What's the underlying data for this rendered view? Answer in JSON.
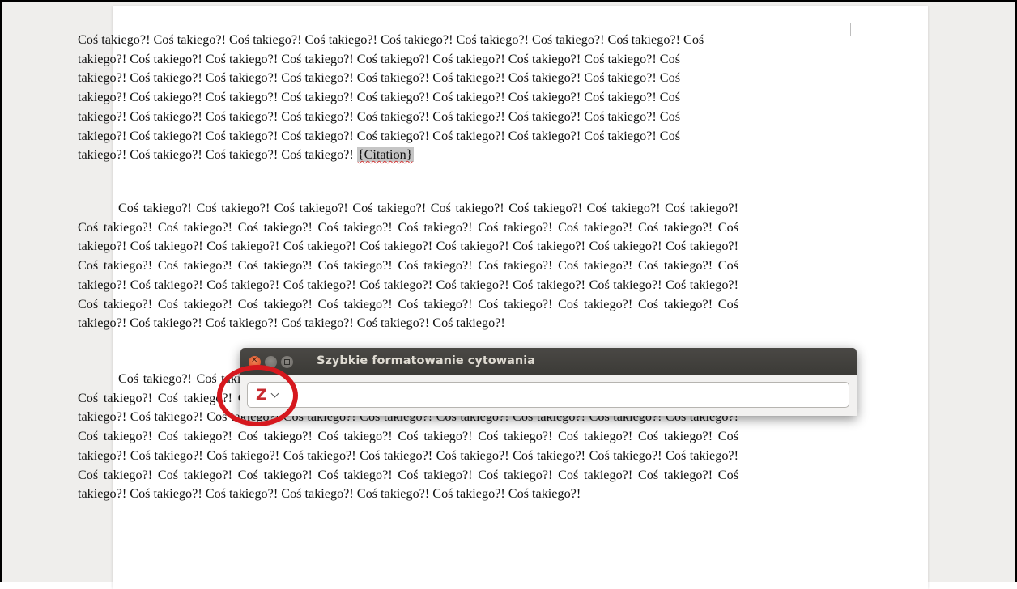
{
  "document": {
    "paragraph_1": "Coś takiego?! Coś takiego?! Coś takiego?! Coś takiego?! Coś takiego?! Coś takiego?! Coś takiego?! Coś takiego?! Coś takiego?! Coś takiego?! Coś takiego?! Coś takiego?! Coś takiego?! Coś takiego?! Coś takiego?! Coś takiego?! Coś takiego?! Coś takiego?! Coś takiego?! Coś takiego?! Coś takiego?! Coś takiego?! Coś takiego?! Coś takiego?! Coś takiego?! Coś takiego?! Coś takiego?! Coś takiego?! Coś takiego?! Coś takiego?! Coś takiego?! Coś takiego?! Coś takiego?! Coś takiego?! Coś takiego?! Coś takiego?! Coś takiego?! Coś takiego?! Coś takiego?! Coś takiego?! Coś takiego?! Coś takiego?! Coś takiego?! Coś takiego?! Coś takiego?! Coś takiego?! Coś takiego?! Coś takiego?! Coś takiego?! Coś takiego?! Coś takiego?! Coś takiego?!",
    "citation_field": "{Citation}",
    "paragraph_2": "Coś takiego?! Coś takiego?! Coś takiego?! Coś takiego?! Coś takiego?! Coś takiego?! Coś takiego?! Coś takiego?! Coś takiego?! Coś takiego?! Coś takiego?! Coś takiego?! Coś takiego?! Coś takiego?! Coś takiego?! Coś takiego?! Coś takiego?! Coś takiego?! Coś takiego?! Coś takiego?! Coś takiego?! Coś takiego?! Coś takiego?! Coś takiego?! Coś takiego?! Coś takiego?! Coś takiego?! Coś takiego?! Coś takiego?! Coś takiego?! Coś takiego?! Coś takiego?! Coś takiego?! Coś takiego?! Coś takiego?! Coś takiego?! Coś takiego?! Coś takiego?! Coś takiego?! Coś takiego?! Coś takiego?! Coś takiego?! Coś takiego?! Coś takiego?! Coś takiego?! Coś takiego?! Coś takiego?! Coś takiego?! Coś takiego?! Coś takiego?! Coś takiego?! Coś takiego?! Coś takiego?! Coś takiego?! Coś takiego?! Coś takiego?!",
    "paragraph_3": "Coś takiego?! Coś takiego?! Coś takiego?! Coś takiego?! Coś takiego?! Coś takiego?! Coś takiego?! Coś takiego?! Coś takiego?! Coś takiego?! Coś takiego?! Coś takiego?! Coś takiego?! Coś takiego?! Coś takiego?! Coś takiego?! Coś takiego?! Coś takiego?! Coś takiego?! Coś takiego?! Coś takiego?! Coś takiego?! Coś takiego?! Coś takiego?! Coś takiego?! Coś takiego?! Coś takiego?! Coś takiego?! Coś takiego?! Coś takiego?! Coś takiego?! Coś takiego?! Coś takiego?! Coś takiego?! Coś takiego?! Coś takiego?! Coś takiego?! Coś takiego?! Coś takiego?! Coś takiego?! Coś takiego?! Coś takiego?! Coś takiego?! Coś takiego?! Coś takiego?! Coś takiego?! Coś takiego?! Coś takiego?! Coś takiego?! Coś takiego?! Coś takiego?! Coś takiego?! Coś takiego?! Coś takiego?! Coś takiego?! Coś takiego?! Coś takiego?!"
  },
  "dialog": {
    "title": "Szybkie formatowanie cytowania",
    "buttons": {
      "close_icon": "close-icon",
      "minimize_icon": "minimize-icon",
      "maximize_icon": "maximize-icon"
    },
    "search": {
      "value": "",
      "zotero_button_label": "Z",
      "zotero_icon": "zotero-logo-icon",
      "dropdown_icon": "chevron-down-icon"
    }
  },
  "annotation": {
    "color": "#d6181e"
  }
}
